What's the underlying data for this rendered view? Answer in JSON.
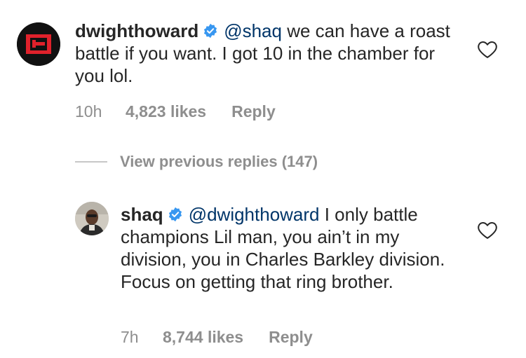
{
  "comments": [
    {
      "username": "dwighthoward",
      "mention": "@shaq",
      "text": " we can have a roast battle if you want. I got 10 in the chamber for you lol.",
      "time": "10h",
      "likes": "4,823 likes",
      "reply_label": "Reply"
    },
    {
      "username": "shaq",
      "mention": "@dwighthoward",
      "text": " I only battle champions Lil man, you ain’t in my division, you in Charles Barkley division. Focus on getting that ring brother.",
      "time": "7h",
      "likes": "8,744 likes",
      "reply_label": "Reply"
    }
  ],
  "view_previous": "View previous replies (147)",
  "colors": {
    "text": "#262626",
    "mention": "#003569",
    "meta": "#8e8e8e",
    "verified": "#3897f0",
    "dwight_avatar_bg": "#111111",
    "dwight_avatar_logo": "#e0212b"
  },
  "icons": {
    "verified": "verified-badge-icon",
    "like": "heart-outline-icon"
  }
}
